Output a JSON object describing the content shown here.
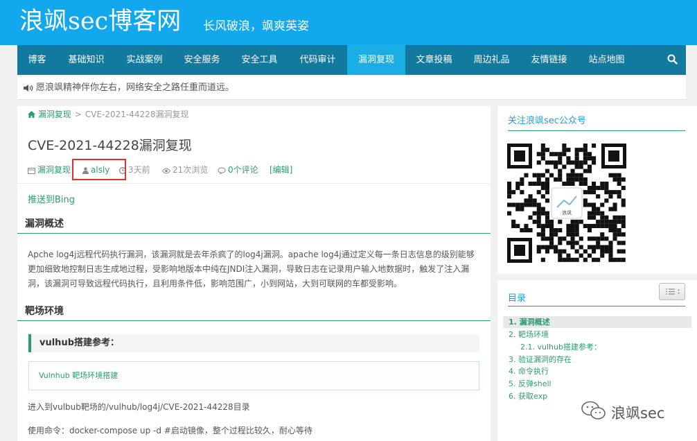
{
  "header": {
    "title": "浪飒sec博客网",
    "slogan": "长风破浪，飒爽英姿"
  },
  "nav": {
    "items": [
      "博客",
      "基础知识",
      "实战案例",
      "安全服务",
      "安全工具",
      "代码审计",
      "漏洞复现",
      "文章投稿",
      "周边礼品",
      "友情链接",
      "站点地图"
    ],
    "active_index": 6,
    "search_icon": "search-icon"
  },
  "notice": {
    "icon": "speaker-icon",
    "text": "愿浪飒精神伴你左右，网络安全之路任重而道远。"
  },
  "breadcrumb": {
    "home_icon": "home-icon",
    "category": "漏洞复现",
    "separator": ">",
    "current": "CVE-2021-44228漏洞复现"
  },
  "post": {
    "title": "CVE-2021-44228漏洞复现",
    "meta": {
      "category": "漏洞复现",
      "author": "alsly",
      "time": "3天前",
      "views": "21次浏览",
      "comments": "0个评论",
      "edit": "[编辑]"
    },
    "push_bing": "推送到Bing",
    "section1_title": "漏洞概述",
    "section1_text": "Apche log4j远程代码执行漏洞，该漏洞就是去年杀疯了的log4j漏洞。apache log4j通过定义每一条日志信息的级别能够更加细致地控制日志生成地过程，受影响地版本中纯在JNDI注入漏洞，导致日志在记录用户输入地数据时，触发了注入漏洞，该漏洞可导致远程代码执行，且利用条件低，影响范围广，小到网站，大到可联网的车都受影响。",
    "section2_title": "靶场环境",
    "subsection_title": "vulhub搭建参考：",
    "box_link": "Vulnhub 靶场环境搭建",
    "line1": "进入到vulbub靶场的/vulhub/log4j/CVE-2021-44228目录",
    "line2": "使用命令：docker-compose up -d #启动镜像，整个过程比较久，耐心等待"
  },
  "sidebar": {
    "qr_title": "关注浪飒sec公众号",
    "qr_center_text": "浪飒",
    "toc_title": "目录",
    "toc_items": [
      "1. 漏洞概述",
      "2. 靶场环境",
      "2.1. vulhub搭建参考：",
      "3. 验证漏洞的存在",
      "4. 命令执行",
      "5. 反弹shell",
      "6. 获取exp"
    ]
  },
  "watermark": {
    "text": "浪飒sec",
    "icon": "wechat-icon"
  },
  "colors": {
    "header": "#11a8ed",
    "nav": "#127a9e",
    "nav_active": "#1baee4",
    "green": "#2a9d70",
    "sidebar_title": "#1fa1d8"
  }
}
